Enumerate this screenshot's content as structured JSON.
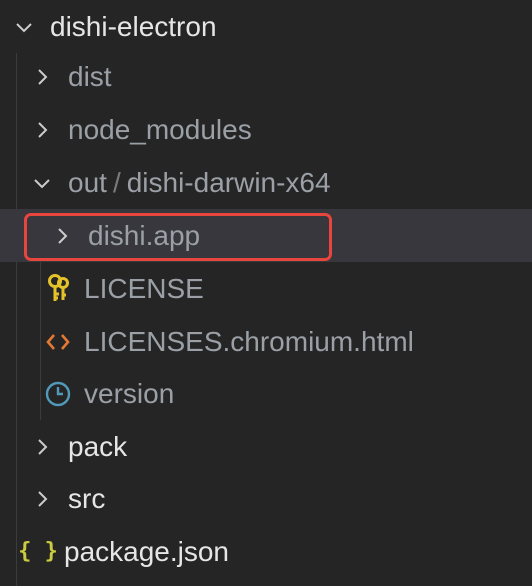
{
  "explorer": {
    "root": {
      "label": "dishi-electron",
      "expanded": true
    },
    "items": [
      {
        "label": "dist",
        "kind": "folder",
        "expanded": false
      },
      {
        "label": "node_modules",
        "kind": "folder",
        "expanded": false
      },
      {
        "label_parent": "out",
        "label_child": "dishi-darwin-x64",
        "kind": "folder",
        "expanded": true
      },
      {
        "label": "dishi.app",
        "kind": "folder",
        "expanded": false,
        "selected": true,
        "highlighted": true
      },
      {
        "label": "LICENSE",
        "kind": "file",
        "icon": "key-icon"
      },
      {
        "label": "LICENSES.chromium.html",
        "kind": "file",
        "icon": "html-code-icon"
      },
      {
        "label": "version",
        "kind": "file",
        "icon": "clock-icon"
      },
      {
        "label": "pack",
        "kind": "folder",
        "expanded": false
      },
      {
        "label": "src",
        "kind": "folder",
        "expanded": false
      },
      {
        "label": "package.json",
        "kind": "file",
        "icon": "json-braces-icon"
      }
    ]
  },
  "colors": {
    "background": "#252526",
    "selected_row": "#37373d",
    "highlight_border": "#e8453c",
    "key_icon": "#e6c229",
    "html_icon": "#e37933",
    "clock_icon": "#519aba",
    "json_icon": "#cbcb41"
  }
}
